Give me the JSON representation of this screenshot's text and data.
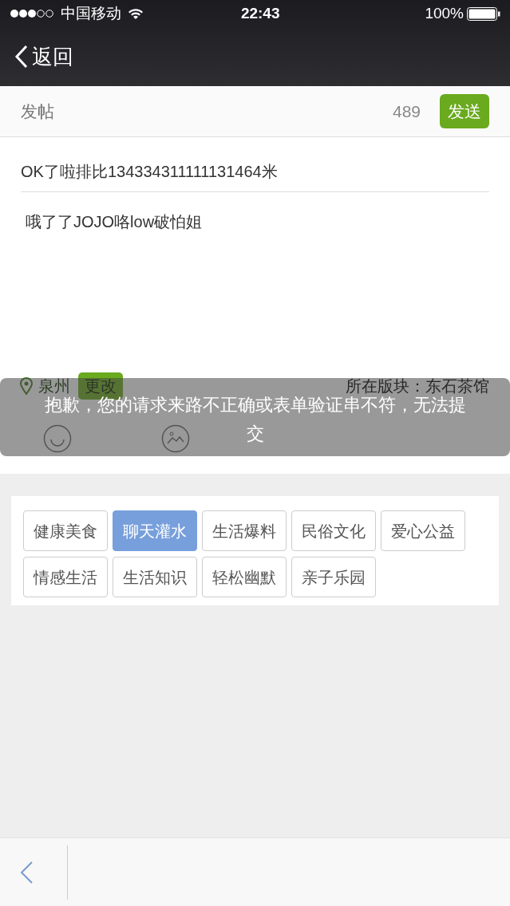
{
  "status_bar": {
    "carrier": "中国移动",
    "time": "22:43",
    "battery": "100%"
  },
  "nav": {
    "back_label": "返回"
  },
  "post_header": {
    "title": "发帖",
    "count": "489",
    "send_button": "发送"
  },
  "title_field": {
    "value": "OK了啦排比134334311111131464米"
  },
  "body_field": {
    "value": "哦了了JOJO咯low破怕姐"
  },
  "location": {
    "city": "泉州",
    "change_button": "更改",
    "forum": "所在版块：东石茶馆"
  },
  "tags": [
    {
      "label": "健康美食",
      "selected": false
    },
    {
      "label": "聊天灌水",
      "selected": true
    },
    {
      "label": "生活爆料",
      "selected": false
    },
    {
      "label": "民俗文化",
      "selected": false
    },
    {
      "label": "爱心公益",
      "selected": false
    },
    {
      "label": "情感生活",
      "selected": false
    },
    {
      "label": "生活知识",
      "selected": false
    },
    {
      "label": "轻松幽默",
      "selected": false
    },
    {
      "label": "亲子乐园",
      "selected": false
    }
  ],
  "toast": {
    "message": "抱歉，您的请求来路不正确或表单验证串不符，无法提交"
  }
}
